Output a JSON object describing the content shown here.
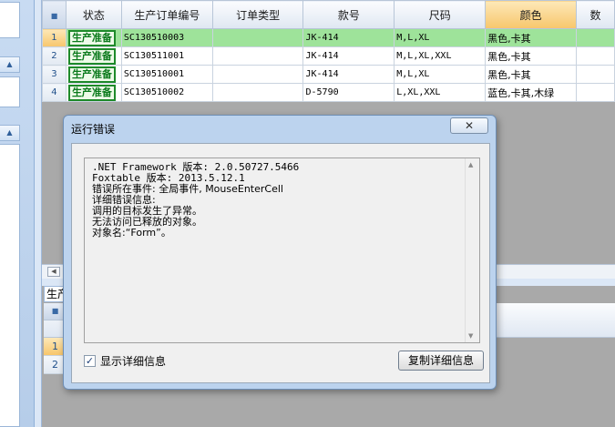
{
  "grid": {
    "columns": [
      "状态",
      "生产订单编号",
      "订单类型",
      "款号",
      "尺码",
      "颜色",
      "数"
    ],
    "rows": [
      {
        "num": "1",
        "status": "生产准备",
        "order_no": "SC130510003",
        "order_type": "",
        "style": "JK-414",
        "size": "M,L,XL",
        "color": "黑色,卡其"
      },
      {
        "num": "2",
        "status": "生产准备",
        "order_no": "SC130511001",
        "order_type": "",
        "style": "JK-414",
        "size": "M,L,XL,XXL",
        "color": "黑色,卡其"
      },
      {
        "num": "3",
        "status": "生产准备",
        "order_no": "SC130510001",
        "order_type": "",
        "style": "JK-414",
        "size": "M,L,XL",
        "color": "黑色,卡其"
      },
      {
        "num": "4",
        "status": "生产准备",
        "order_no": "SC130510002",
        "order_type": "",
        "style": "D-5790",
        "size": "L,XL,XXL",
        "color": "蓝色,卡其,木绿"
      }
    ]
  },
  "lower": {
    "tab_label": "生产",
    "row_numbers": [
      "1",
      "2"
    ]
  },
  "dialog": {
    "title": "运行错误",
    "close_label": "✕",
    "error_lines": [
      ".NET Framework 版本: 2.0.50727.5466",
      "Foxtable 版本: 2013.5.12.1",
      "错误所在事件: 全局事件, MouseEnterCell",
      "详细错误信息:",
      "调用的目标发生了异常。",
      "无法访问已释放的对象。",
      "对象名:“Form”。"
    ],
    "show_details_label": "显示详细信息",
    "show_details_checked": "✓",
    "copy_button_label": "复制详细信息"
  },
  "icons": {
    "corner": "lock-icon",
    "close": "close-icon",
    "collapse": "chevron-up-icon"
  }
}
